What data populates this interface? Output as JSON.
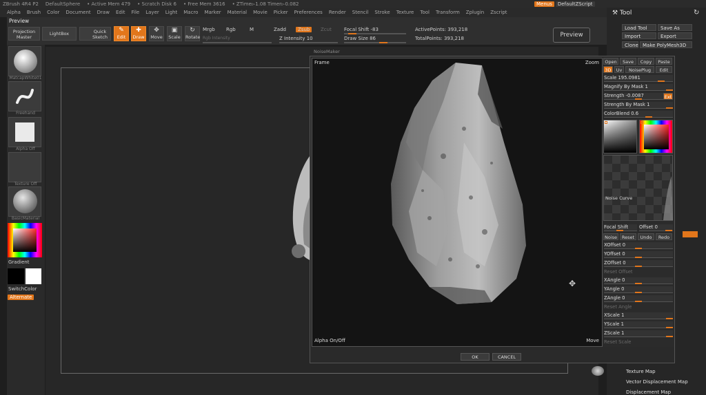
{
  "titlebar": {
    "app": "ZBrush 4R4 P2",
    "document": "DefaultSphere",
    "active_mem": "• Active Mem 479",
    "scratch_disk": "• Scratch Disk 6",
    "free_mem": "• Free Mem 3616",
    "ztime": "• ZTime▻1.08 Timer▻0.082"
  },
  "menus": [
    "Alpha",
    "Brush",
    "Color",
    "Document",
    "Draw",
    "Edit",
    "File",
    "Layer",
    "Light",
    "Macro",
    "Marker",
    "Material",
    "Movie",
    "Picker",
    "Preferences",
    "Render",
    "Stencil",
    "Stroke",
    "Texture",
    "Tool",
    "Transform",
    "Zplugin",
    "Zscript"
  ],
  "top_right": {
    "menus_button": "Menus",
    "script_button": "DefaultZScript"
  },
  "shelf": {
    "preview_label": "Preview",
    "projection_master": "Projection Master",
    "lightbox": "LightBox",
    "quick_sketch": "Quick Sketch",
    "edit": "Edit",
    "draw": "Draw",
    "move": "Move",
    "scale": "Scale",
    "rotate": "Rotate",
    "mrgb": "Mrgb",
    "rgb": "Rgb",
    "m": "M",
    "rgb_intensity": "Rgb Intensity",
    "zadd": "Zadd",
    "zsub": "Zsub",
    "zcut": "Zcut",
    "z_intensity": "Z Intensity 10",
    "focal_shift": "Focal Shift -83",
    "draw_size": "Draw Size 86",
    "active_points": "ActivePoints: 393,218",
    "total_points": "TotalPoints: 393,218",
    "preview_button": "Preview"
  },
  "left_tray": {
    "material_label": "MatcapWhite01",
    "stroke_label": "Freehand",
    "alpha_label": "Alpha Off",
    "texture_label": "Texture Off",
    "material2_label": "BasicMaterial",
    "gradient": "Gradient",
    "switch_color": "SwitchColor",
    "alternate": "Alternate"
  },
  "right_panel": {
    "title": "Tool",
    "load_tool": "Load Tool",
    "save_as": "Save As",
    "import": "Import",
    "export": "Export",
    "clone": "Clone",
    "make_polymesh": "Make PolyMesh3D",
    "texture_map": "Texture Map",
    "vector_displacement_map": "Vector Displacement Map",
    "displacement_map": "Displacement Map"
  },
  "noise": {
    "window_title": "NoiseMaker",
    "frame": "Frame",
    "zoom": "Zoom",
    "alpha_onoff": "Alpha On/Off",
    "move": "Move",
    "open": "Open",
    "save": "Save",
    "copy": "Copy",
    "paste": "Paste",
    "mode_3d": "3D",
    "mode_uv": "Uv",
    "noise_plug": "NoisePlug",
    "edit": "Edit",
    "scale": "Scale 195.0981",
    "magnify_by_mask": "Magnify By Mask 1",
    "strength": "Strength -0.0087",
    "strength_button": "Ext",
    "strength_by_mask": "Strength By Mask 1",
    "color_blend": "ColorBlend 0.6",
    "noise_curve": "Noise Curve",
    "focal_shift": "Focal Shift",
    "offset": "Offset 0",
    "noise_btn": "Noise",
    "reset_btn": "Reset",
    "undo_btn": "Undo",
    "redo_btn": "Redo",
    "xoffset": "XOffset 0",
    "yoffset": "YOffset 0",
    "zoffset": "ZOffset 0",
    "reset_offset": "Reset Offset",
    "xangle": "XAngle 0",
    "yangle": "YAngle 0",
    "zangle": "ZAngle 0",
    "reset_angle": "Reset Angle",
    "xscale": "XScale 1",
    "yscale": "YScale 1",
    "zscale": "ZScale 1",
    "reset_scale": "Reset Scale",
    "ok": "OK",
    "cancel": "CANCEL"
  },
  "colors": {
    "accent": "#e2761b",
    "panel": "#2a2a2a",
    "canvas": "#272727"
  }
}
